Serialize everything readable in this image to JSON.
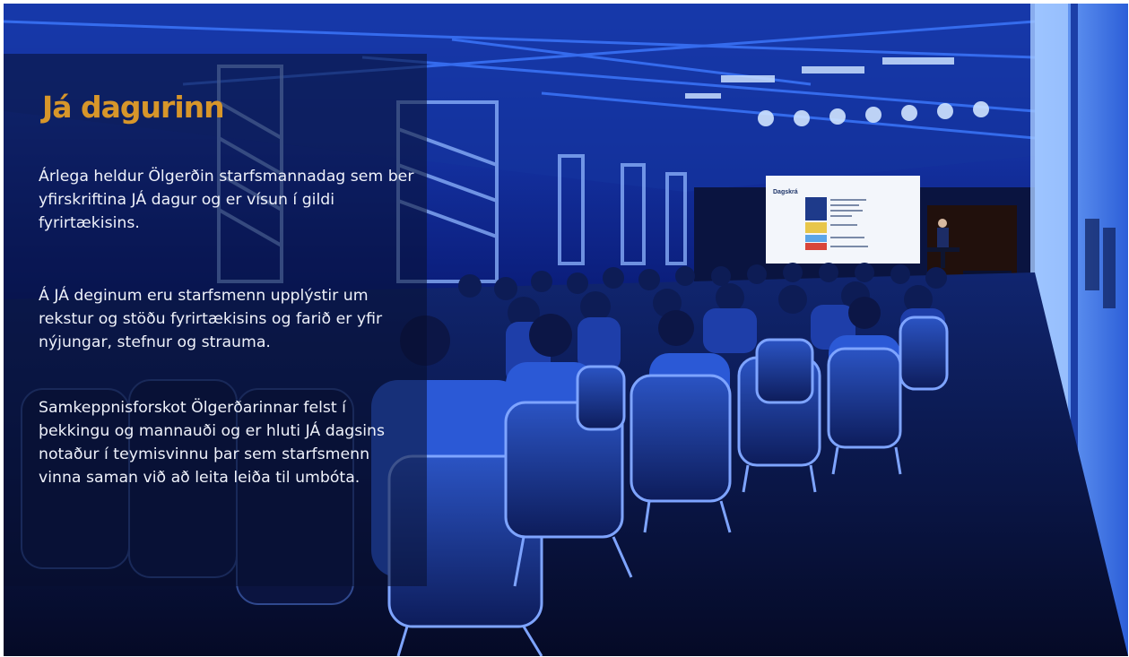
{
  "heading": "Já dagurinn",
  "paragraphs": [
    "Árlega heldur Ölgerðin starfsmannadag sem ber yfirskriftina JÁ dagur og er vísun í gildi fyrirtækisins.",
    "Á JÁ deginum eru starfsmenn upplýstir um rekstur og stöðu fyrirtækisins og farið er yfir nýjungar, stefnur og strauma.",
    "Samkeppnisforskot Ölgerðarinnar felst í þekkingu og mannauði og er hluti JÁ dagsins notaður í teymisvinnu þar sem starfsmenn vinna saman við að leita leiða til umbóta."
  ],
  "projection_slide": {
    "title": "Dagskrá"
  },
  "colors": {
    "heading": "#d7962a",
    "body_text": "#eef1fa",
    "overlay": "#080e2d",
    "stage_light": "#1b3ec8"
  }
}
